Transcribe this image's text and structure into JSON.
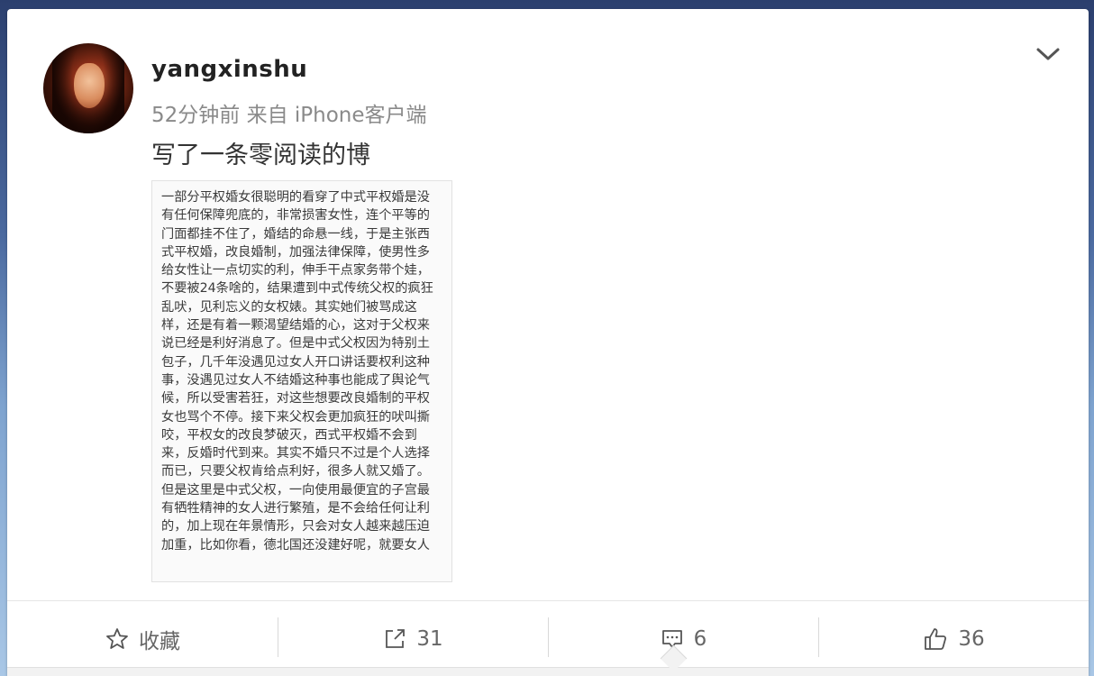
{
  "post": {
    "username": "yangxinshu",
    "meta": "52分钟前 来自 iPhone客户端",
    "text": "写了一条零阅读的博",
    "image_text": "一部分平权婚女很聪明的看穿了中式平权婚是没有任何保障兜底的，非常损害女性，连个平等的门面都挂不住了，婚结的命悬一线，于是主张西式平权婚，改良婚制，加强法律保障，使男性多给女性让一点切实的利，伸手干点家务带个娃，不要被24条啥的，结果遭到中式传统父权的疯狂乱吠，见利忘义的女权婊。其实她们被骂成这样，还是有着一颗渴望结婚的心，这对于父权来说已经是利好消息了。但是中式父权因为特别土包子，几千年没遇见过女人开口讲话要权利这种事，没遇见过女人不结婚这种事也能成了舆论气候，所以受害若狂，对这些想要改良婚制的平权女也骂个不停。接下来父权会更加疯狂的吠叫撕咬，平权女的改良梦破灭，西式平权婚不会到来，反婚时代到来。其实不婚只不过是个人选择而已，只要父权肯给点利好，很多人就又婚了。但是这里是中式父权，一向使用最便宜的子宫最有牺牲精神的女人进行繁殖，是不会给任何让利的，加上现在年景情形，只会对女人越来越压迫加重，比如你看，德北国还没建好呢，就要女人"
  },
  "actions": {
    "favorite_label": "收藏",
    "repost_count": "31",
    "comment_count": "6",
    "like_count": "36"
  },
  "icons": {
    "menu": "chevron-down-icon",
    "favorite": "star-icon",
    "repost": "share-icon",
    "comment": "comment-icon",
    "like": "thumbs-up-icon"
  }
}
